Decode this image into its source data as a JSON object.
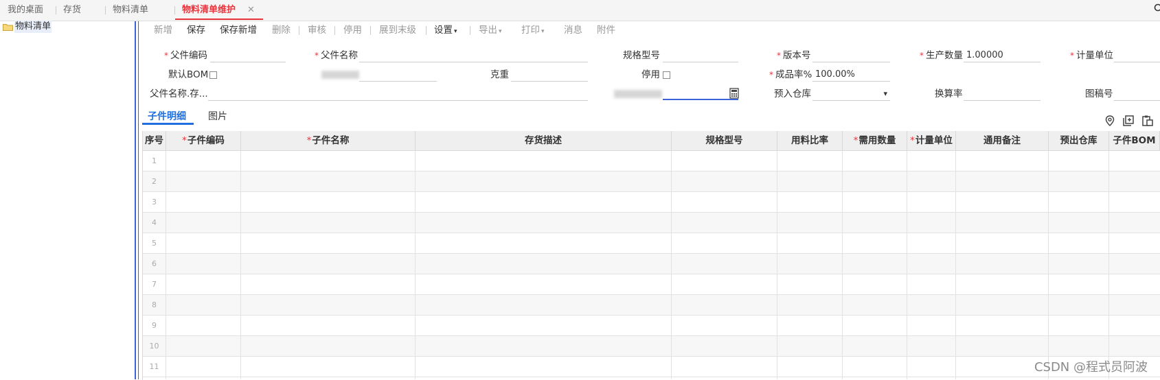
{
  "tabs": [
    {
      "label": "我的桌面",
      "active": false
    },
    {
      "label": "存货",
      "active": false
    },
    {
      "label": "物料清单",
      "active": false
    },
    {
      "label": "物料清单维护",
      "active": true
    }
  ],
  "tab_close": "✕",
  "tree": {
    "root_label": "物料清单"
  },
  "toolbar": {
    "new": "新增",
    "save": "保存",
    "save_new": "保存新增",
    "delete": "删除",
    "audit": "审核",
    "disable": "停用",
    "expand": "展到末级",
    "settings": "设置",
    "export": "导出",
    "print": "打印",
    "message": "消息",
    "attachment": "附件"
  },
  "form": {
    "parent_code_label": "父件编码",
    "parent_name_label": "父件名称",
    "spec_label": "规格型号",
    "version_label": "版本号",
    "prod_qty_label": "生产数量",
    "prod_qty_value": "1.00000",
    "uom_label": "计量单位",
    "default_bom_label": "默认BOM",
    "weight_label": "克重",
    "disable_label": "停用",
    "yield_label": "成品率%",
    "yield_value": "100.00%",
    "parent_name_stock_label": "父件名称.存...",
    "warehouse_label": "预入仓库",
    "conversion_label": "换算率",
    "drawing_label": "图稿号"
  },
  "subtabs": {
    "detail": "子件明细",
    "image": "图片"
  },
  "table": {
    "headers": [
      {
        "label": "序号",
        "required": false
      },
      {
        "label": "子件编码",
        "required": true
      },
      {
        "label": "子件名称",
        "required": true
      },
      {
        "label": "存货描述",
        "required": false
      },
      {
        "label": "规格型号",
        "required": false
      },
      {
        "label": "用料比率",
        "required": false
      },
      {
        "label": "需用数量",
        "required": true
      },
      {
        "label": "计量单位",
        "required": true
      },
      {
        "label": "通用备注",
        "required": false
      },
      {
        "label": "预出仓库",
        "required": false
      },
      {
        "label": "子件BOM",
        "required": false
      }
    ],
    "row_numbers": [
      "1",
      "2",
      "3",
      "4",
      "5",
      "6",
      "7",
      "8",
      "9",
      "10",
      "11"
    ]
  },
  "watermark": "CSDN @程式员阿波",
  "icons": {
    "locate": "location-pin-icon",
    "copy": "copy-row-icon",
    "paste": "paste-icon",
    "calculator": "calculator-icon",
    "folder": "folder-icon"
  }
}
